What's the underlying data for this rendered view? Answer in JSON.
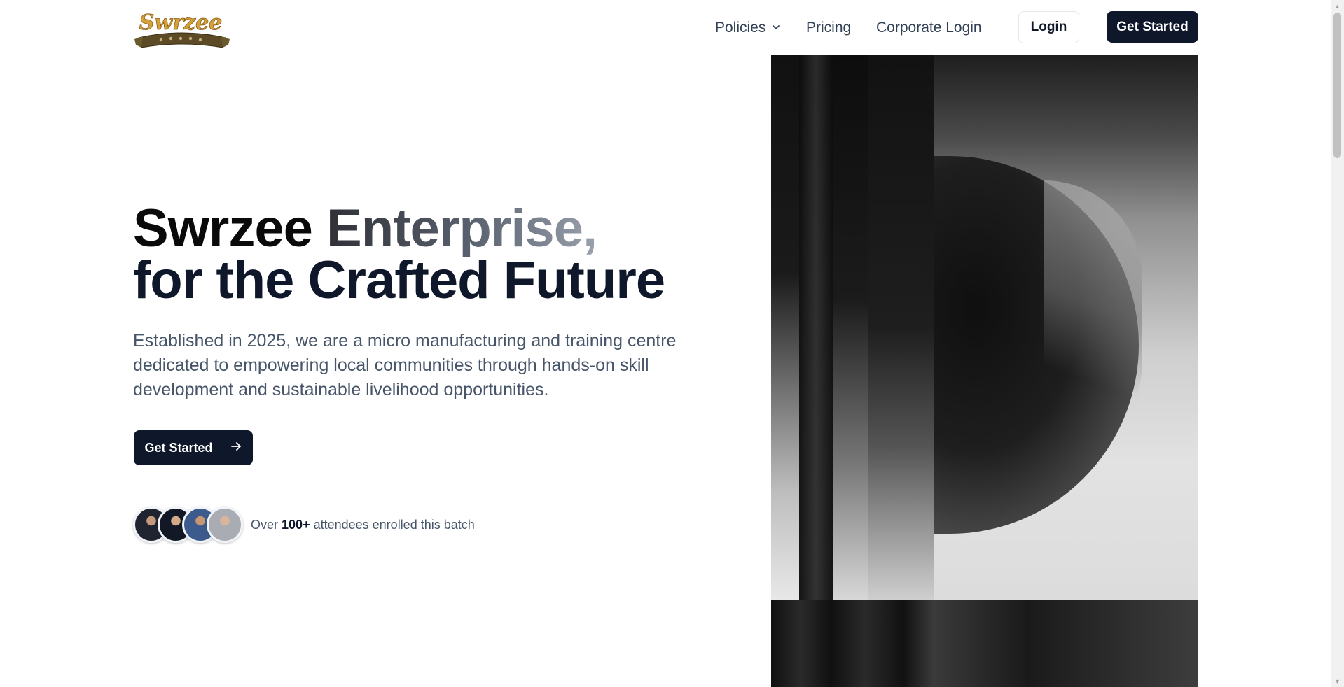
{
  "header": {
    "logo_text": "Swrzee",
    "nav": {
      "policies": "Policies",
      "pricing": "Pricing",
      "corporate_login": "Corporate Login"
    },
    "login": "Login",
    "get_started": "Get Started"
  },
  "hero": {
    "title_part1": "Swrzee",
    "title_part2": "Enterprise,",
    "title_line2": "for the Crafted Future",
    "description": "Established in 2025, we are a micro manufacturing and training centre dedicated to empowering local communities through hands-on skill development and sustainable livelihood opportunities.",
    "cta": "Get Started",
    "attendees_prefix": "Over",
    "attendees_count": "100+",
    "attendees_suffix": "attendees enrolled this batch"
  },
  "colors": {
    "primary": "#0f172a",
    "text_muted": "#475569",
    "logo_gold": "#d4a13a"
  }
}
